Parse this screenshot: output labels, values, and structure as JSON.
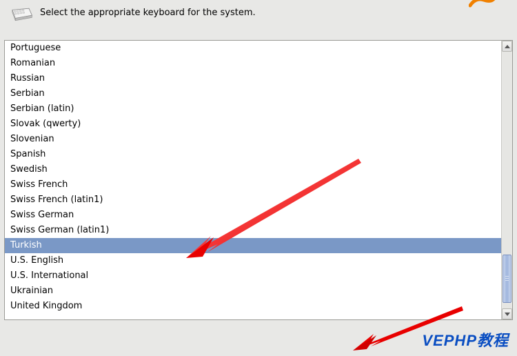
{
  "header": {
    "instruction": "Select the appropriate keyboard for the system."
  },
  "keyboard_list": {
    "selected_index": 13,
    "items": [
      "Portuguese",
      "Romanian",
      "Russian",
      "Serbian",
      "Serbian (latin)",
      "Slovak (qwerty)",
      "Slovenian",
      "Spanish",
      "Swedish",
      "Swiss French",
      "Swiss French (latin1)",
      "Swiss German",
      "Swiss German (latin1)",
      "Turkish",
      "U.S. English",
      "U.S. International",
      "Ukrainian",
      "United Kingdom"
    ]
  },
  "watermark": {
    "text": "VEPHP教程"
  },
  "colors": {
    "selection": "#7a98c6",
    "annotation_arrow": "#ff2a2a",
    "watermark_text": "#0a4ec2"
  }
}
